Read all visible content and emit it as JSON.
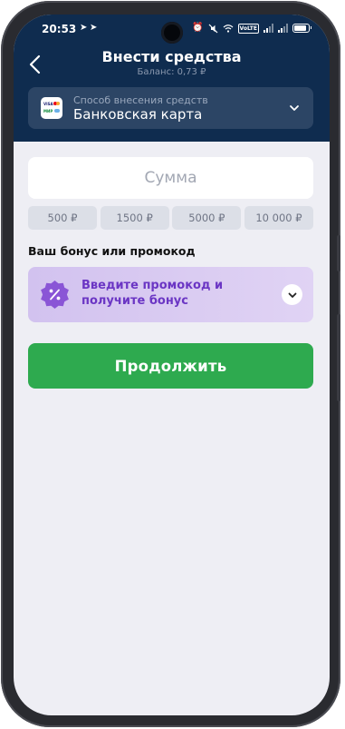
{
  "status_bar": {
    "time": "20:53",
    "telegram_icons": [
      "telegram-icon",
      "telegram-icon"
    ],
    "indicator_icons": [
      "alarm-icon",
      "mute-icon",
      "wifi-icon",
      "volte-icon",
      "signal-icon",
      "signal-icon",
      "battery-icon"
    ],
    "volte_label": "VoLTE",
    "battery_level": 0.85
  },
  "header": {
    "title": "Внести средства",
    "balance": "Баланс: 0,73 ₽",
    "background_color": "#0f2c4f"
  },
  "payment_method": {
    "label": "Способ внесения средств",
    "value": "Банковская карта",
    "logo_text": [
      "VISA",
      "МИР"
    ]
  },
  "amount": {
    "placeholder": "Сумма",
    "value": ""
  },
  "quick_amounts": [
    "500 ₽",
    "1500 ₽",
    "5000 ₽",
    "10 000 ₽"
  ],
  "bonus": {
    "section_label": "Ваш бонус или промокод",
    "promo_text": "Введите промокод и получите бонус",
    "accent_color": "#6b36c4"
  },
  "actions": {
    "continue_label": "Продолжить",
    "continue_color": "#2eaa4f"
  }
}
